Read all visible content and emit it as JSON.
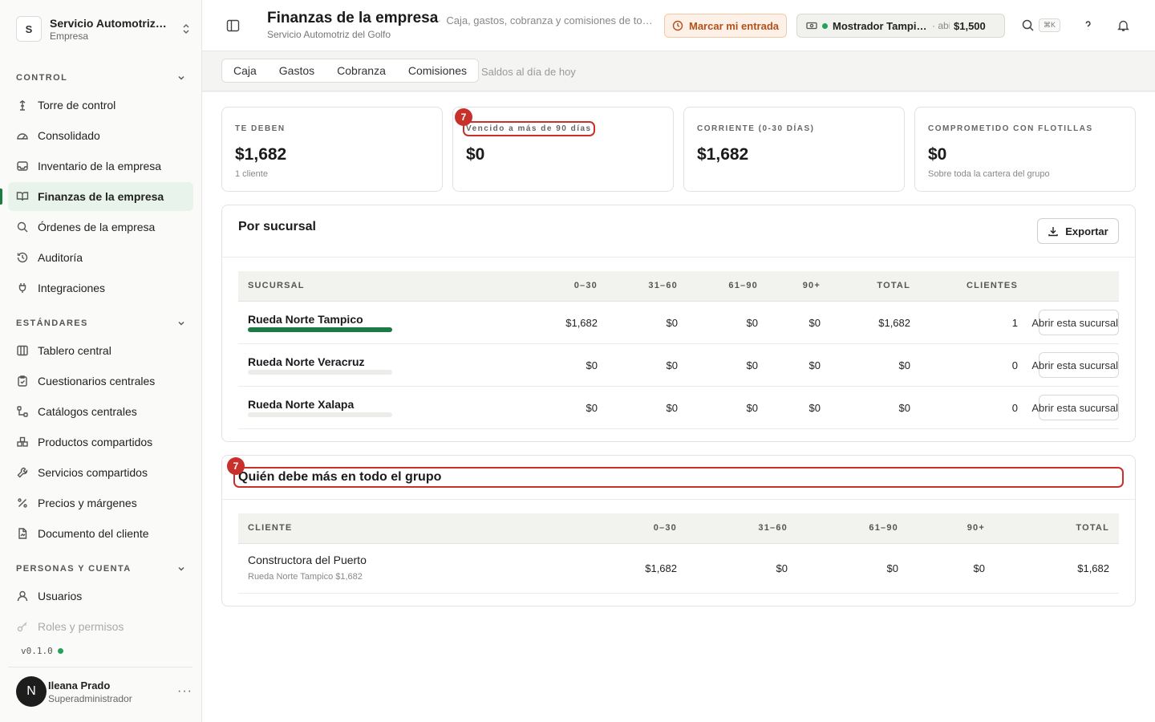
{
  "org": {
    "initial": "S",
    "name": "Servicio Automotriz del Golfo",
    "type": "Empresa"
  },
  "nav": {
    "sections": [
      {
        "title": "CONTROL",
        "items": [
          "Torre de control",
          "Consolidado",
          "Inventario de la empresa",
          "Finanzas de la empresa",
          "Órdenes de la empresa",
          "Auditoría",
          "Integraciones"
        ]
      },
      {
        "title": "ESTÁNDARES",
        "items": [
          "Tablero central",
          "Cuestionarios centrales",
          "Catálogos centrales",
          "Productos compartidos",
          "Servicios compartidos",
          "Precios y márgenes",
          "Documento del cliente"
        ]
      },
      {
        "title": "PERSONAS Y CUENTA",
        "items": [
          "Usuarios",
          "Roles y permisos"
        ]
      }
    ],
    "active": "Finanzas de la empresa"
  },
  "version": "v0.1.0",
  "user": {
    "initial": "N",
    "name": "Ileana Prado",
    "role": "Superadministrador",
    "more": "···"
  },
  "header": {
    "title": "Finanzas de la empresa",
    "subtitle": "Servicio Automotriz del Golfo",
    "description": "Caja, gastos, cobranza y comisiones de todas las sucursales",
    "clock_label": "Marcar mi entrada",
    "register_name": "Mostrador Tampico",
    "register_status": "abierta",
    "register_amount": "$1,500",
    "shortcut": "⌘K"
  },
  "tabs": {
    "items": [
      "Caja",
      "Gastos",
      "Cobranza",
      "Comisiones"
    ],
    "note": "Saldos al día de hoy"
  },
  "kpis": [
    {
      "label": "TE DEBEN",
      "value": "$1,682",
      "hint": "1 cliente"
    },
    {
      "label": "Vencido a más de 90 días",
      "value": "$0",
      "hint": ""
    },
    {
      "label": "CORRIENTE (0-30 DÍAS)",
      "value": "$1,682",
      "hint": ""
    },
    {
      "label": "COMPROMETIDO CON FLOTILLAS",
      "value": "$0",
      "hint": "Sobre toda la cartera del grupo"
    }
  ],
  "badge": "7",
  "branches": {
    "title": "Por sucursal",
    "export_label": "Exportar",
    "open_label": "Abrir esta sucursal",
    "columns": [
      "SUCURSAL",
      "0–30",
      "31–60",
      "61–90",
      "90+",
      "TOTAL",
      "CLIENTES"
    ],
    "rows": [
      {
        "name": "Rueda Norte Tampico",
        "share": 1.0,
        "c0": "$1,682",
        "c1": "$0",
        "c2": "$0",
        "c3": "$0",
        "total": "$1,682",
        "clients": "1"
      },
      {
        "name": "Rueda Norte Veracruz",
        "share": 0.0,
        "c0": "$0",
        "c1": "$0",
        "c2": "$0",
        "c3": "$0",
        "total": "$0",
        "clients": "0"
      },
      {
        "name": "Rueda Norte Xalapa",
        "share": 0.0,
        "c0": "$0",
        "c1": "$0",
        "c2": "$0",
        "c3": "$0",
        "total": "$0",
        "clients": "0"
      }
    ]
  },
  "debtors": {
    "title": "Quién debe más en todo el grupo",
    "columns": [
      "CLIENTE",
      "0–30",
      "31–60",
      "61–90",
      "90+",
      "TOTAL"
    ],
    "rows": [
      {
        "name": "Constructora del Puerto",
        "detail": "Rueda Norte Tampico $1,682",
        "c0": "$1,682",
        "c1": "$0",
        "c2": "$0",
        "c3": "$0",
        "total": "$1,682"
      }
    ]
  },
  "colors": {
    "accent": "#1c7a45",
    "highlight": "#c8302b",
    "clock": "#b4501a"
  }
}
